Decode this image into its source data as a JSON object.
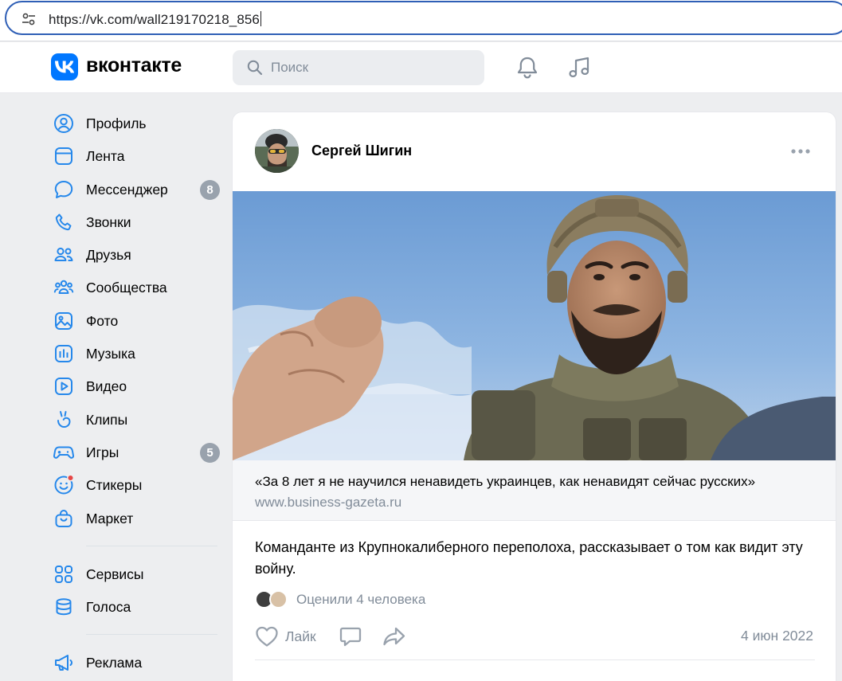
{
  "browser": {
    "url": "https://vk.com/wall219170218_856"
  },
  "header": {
    "brand": "вконтакте",
    "search_placeholder": "Поиск",
    "icons": [
      "bell-icon",
      "music-icon"
    ],
    "accent_color": "#0077ff"
  },
  "sidebar": {
    "items": [
      {
        "label": "Профиль",
        "icon": "user-circle-icon"
      },
      {
        "label": "Лента",
        "icon": "newsfeed-icon"
      },
      {
        "label": "Мессенджер",
        "icon": "message-icon",
        "badge": "8"
      },
      {
        "label": "Звонки",
        "icon": "phone-icon"
      },
      {
        "label": "Друзья",
        "icon": "friends-icon"
      },
      {
        "label": "Сообщества",
        "icon": "communities-icon"
      },
      {
        "label": "Фото",
        "icon": "photo-icon"
      },
      {
        "label": "Музыка",
        "icon": "music-bars-icon"
      },
      {
        "label": "Видео",
        "icon": "video-icon"
      },
      {
        "label": "Клипы",
        "icon": "clips-icon"
      },
      {
        "label": "Игры",
        "icon": "gamepad-icon",
        "badge": "5"
      },
      {
        "label": "Стикеры",
        "icon": "sticker-icon",
        "dot": true
      },
      {
        "label": "Маркет",
        "icon": "market-bag-icon"
      }
    ],
    "items2": [
      {
        "label": "Сервисы",
        "icon": "services-grid-icon"
      },
      {
        "label": "Голоса",
        "icon": "votes-coins-icon"
      }
    ],
    "items3": [
      {
        "label": "Реклама",
        "icon": "megaphone-icon"
      }
    ]
  },
  "post": {
    "author": "Сергей Шигин",
    "snippet": {
      "title": "«За 8 лет я не научился ненавидеть украинцев, как ненавидят сейчас русских»",
      "domain": "www.business-gazeta.ru"
    },
    "text": "Команданте из Крупнокалиберного переполоха, рассказывает о том как видит эту войну.",
    "likers_text": "Оценили 4 человека",
    "like_label": "Лайк",
    "date": "4 июн 2022"
  }
}
